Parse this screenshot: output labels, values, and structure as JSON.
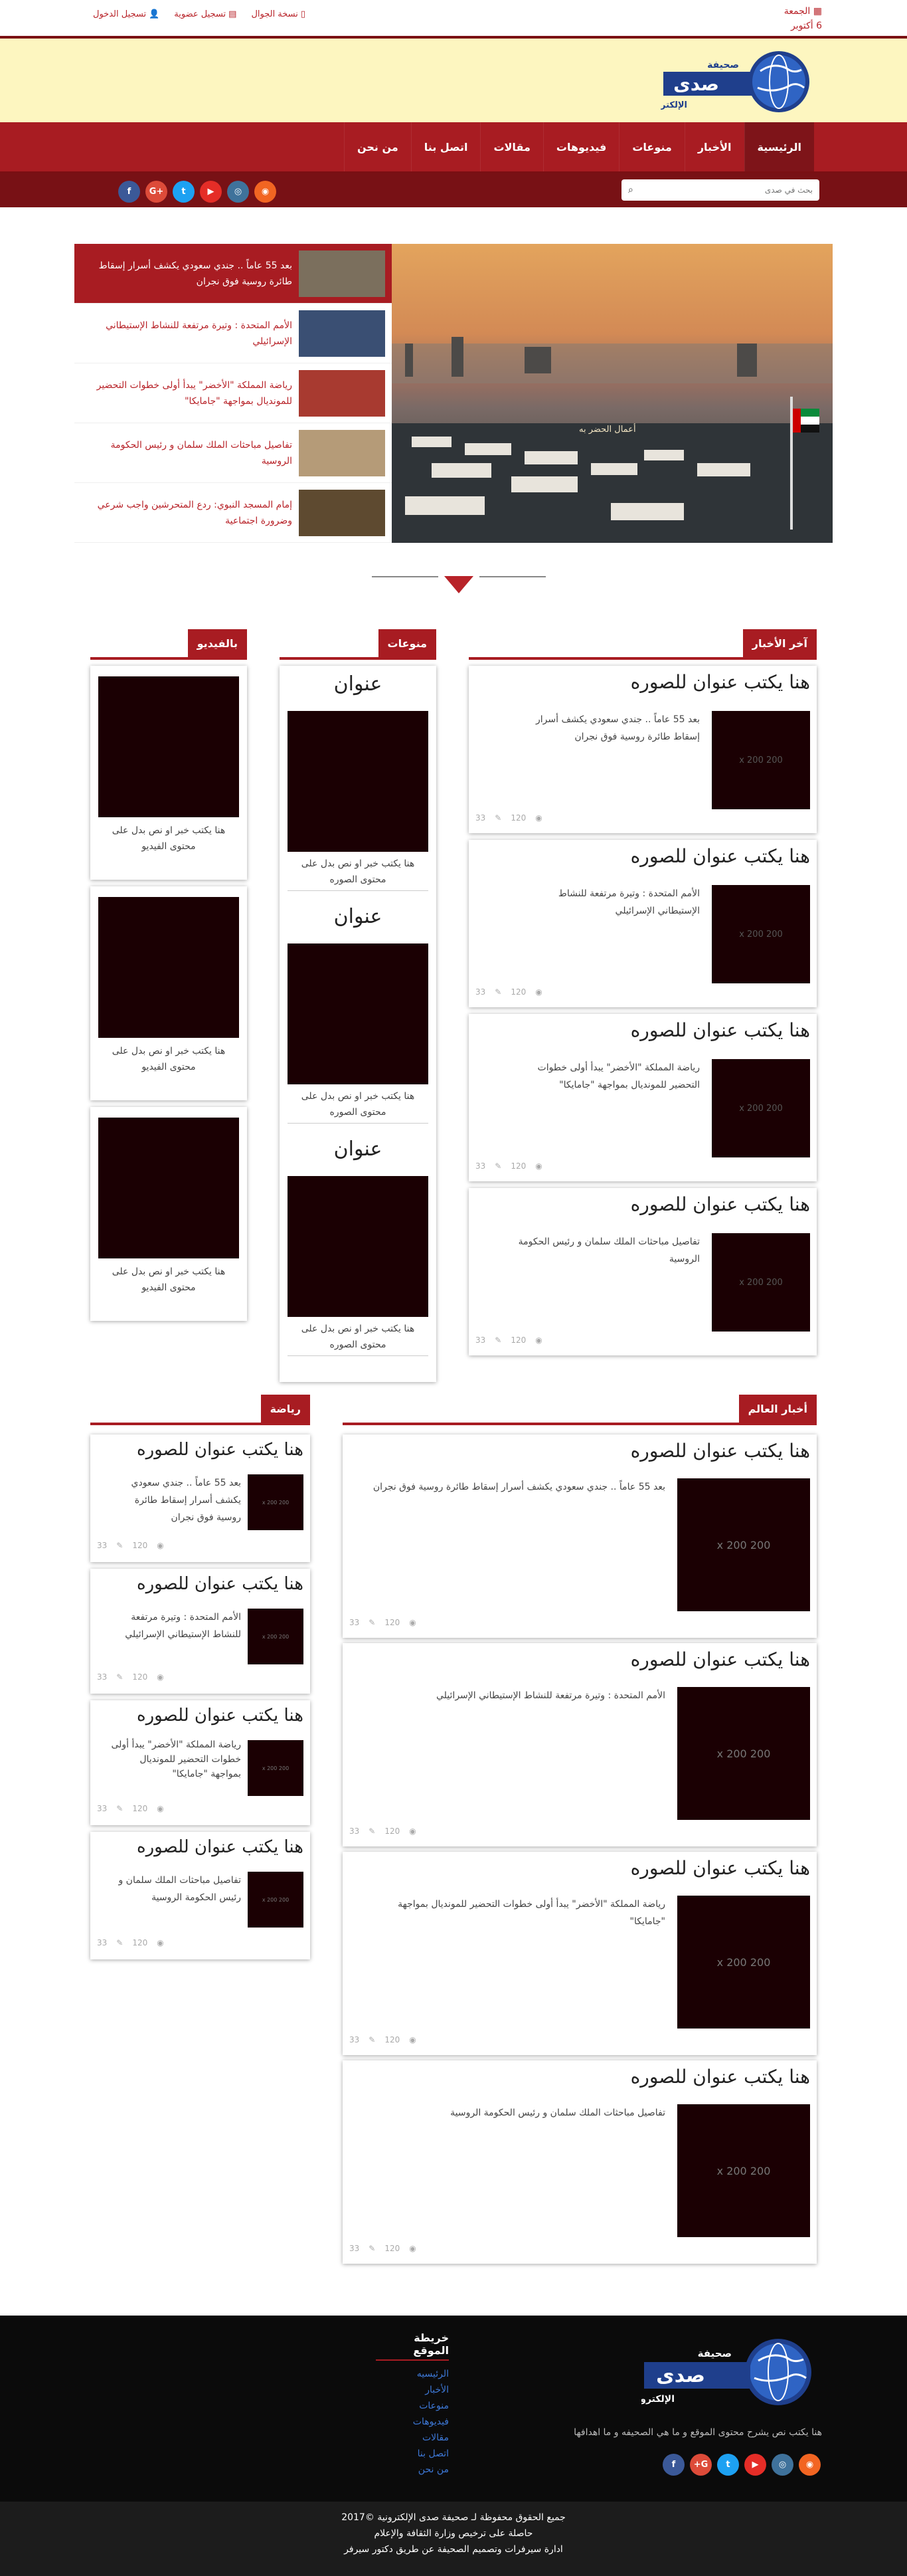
{
  "topbar": {
    "date": "الجمعة 6 أكتوبر",
    "login": "تسجيل الدخول",
    "register": "تسجيل عضوية",
    "mobile": "نسخة الجوال"
  },
  "logo": {
    "line1": "صحيفة",
    "line2": "صدى",
    "line3": "الإلكترونية"
  },
  "nav": [
    "الرئيسية",
    "الأخبار",
    "منوعات",
    "فيديوهات",
    "مقالات",
    "اتصل بنا",
    "من نحن"
  ],
  "search": {
    "placeholder": "بحث في صدى"
  },
  "social_icons": [
    "rss-icon",
    "instagram-icon",
    "youtube-icon",
    "twitter-icon",
    "google-plus-icon",
    "facebook-icon"
  ],
  "slider": {
    "image_caption": "أعمال الحضر به",
    "items": [
      "بعد 55 عاماً .. جندي سعودي يكشف أسرار إسقاط طائرة روسية فوق نجران",
      "الأمم المتحدة : وتيرة مرتفعة للنشاط الإستيطاني الإسرائيلي",
      "رياضة المملكة \"الأخضر\" يبدأ أولى خطوات التحضير للمونديال بمواجهة \"جامايكا\"",
      "تفاصيل مباحثات الملك سلمان و رئيس الحكومة الروسية",
      "إمام المسجد النبوي: ردع المتحرشين واجب شرعي وضرورة اجتماعية"
    ]
  },
  "sections": {
    "latest": "آخر الأخبار",
    "misc": "منوعات",
    "video": "بالفيديو",
    "world": "أخبار العالم",
    "sports": "رياضة"
  },
  "card_title": "هنا يكتب عنوان للصوره",
  "img_placeholder": "200 x 200",
  "img_placeholder_small": "200 x 200",
  "meta": {
    "comments": "33",
    "views": "120"
  },
  "news_desc": [
    "بعد 55 عاماً .. جندي سعودي يكشف أسرار إسقاط طائرة روسية فوق نجران",
    "الأمم المتحدة : وتيرة مرتفعة للنشاط الإستيطاني الإسرائيلي",
    "رياضة المملكة \"الأخضر\" يبدأ أولى خطوات التحضير للمونديال بمواجهة \"جامايكا\"",
    "تفاصيل مباحثات الملك سلمان و رئيس الحكومة الروسية"
  ],
  "misc_items": {
    "heading": "عنوان",
    "caption": "هنا يكتب خبر او نص بدل على محتوى الصوره"
  },
  "video_caption": "هنا يكتب خبر او نص بدل على محتوى الفيديو",
  "footer": {
    "sitemap_title": "خريطة الموقع",
    "sitemap": [
      "الرئيسيه",
      "الأخبار",
      "منوعات",
      "فيديوهات",
      "مقالات",
      "اتصل بنا",
      "من نحن"
    ],
    "desc": "هنا يكتب نص يشرح محتوى الموقع و ما هي الصحيفه و ما اهدافها",
    "copyright1": "جميع الحقوق محفوظة لـ صحيفة صدى الإلكترونية ©2017",
    "copyright2": "حاصلة على ترخيص وزارة الثقافة والإعلام",
    "copyright3": "ادارة سيرفرات وتصميم الصحيفة عن طريق دكتور سيرفر"
  },
  "colors": {
    "brand": "#a81c22",
    "header_bg": "#fdf6c0",
    "dark": "#781115"
  }
}
